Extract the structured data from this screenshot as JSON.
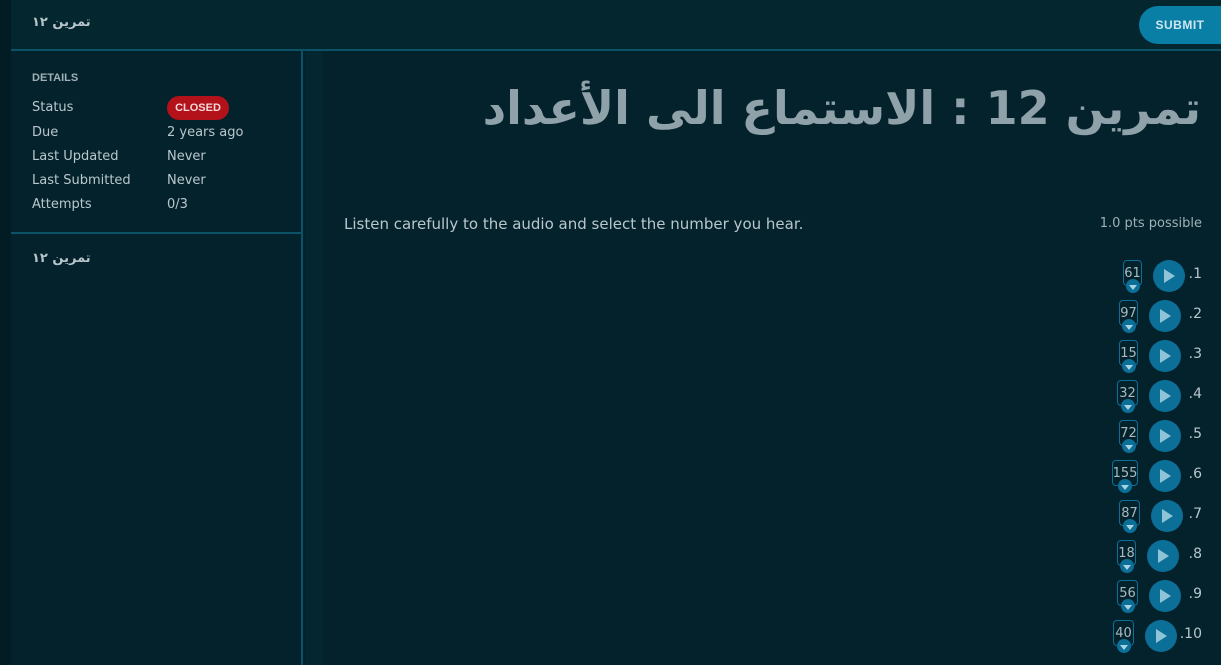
{
  "header": {
    "title": "تمرين ١٢",
    "submit_label": "SUBMIT"
  },
  "details": {
    "heading": "DETAILS",
    "rows": [
      {
        "label": "Status",
        "value": "CLOSED"
      },
      {
        "label": "Due",
        "value": "2 years ago"
      },
      {
        "label": "Last Updated",
        "value": "Never"
      },
      {
        "label": "Last Submitted",
        "value": "Never"
      },
      {
        "label": "Attempts",
        "value": "0/3"
      }
    ]
  },
  "sidebar": {
    "link_label": "تمرين ١٢"
  },
  "main": {
    "title": "تمرين 12 : الاستماع الى الأعداد",
    "instructions": "Listen carefully to the audio and select the number you hear.",
    "points": "1.0 pts possible",
    "questions": [
      {
        "num": ".1",
        "value": "61"
      },
      {
        "num": ".2",
        "value": "97"
      },
      {
        "num": ".3",
        "value": "15"
      },
      {
        "num": ".4",
        "value": "32"
      },
      {
        "num": ".5",
        "value": "72"
      },
      {
        "num": ".6",
        "value": "155"
      },
      {
        "num": ".7",
        "value": "87"
      },
      {
        "num": ".8",
        "value": "18"
      },
      {
        "num": ".9",
        "value": "56"
      },
      {
        "num": ".10",
        "value": "40"
      }
    ]
  },
  "colors": {
    "background": "#04222c",
    "accent": "#0a7fa6",
    "border": "#0b5266",
    "status_closed": "#b3121a"
  },
  "icons": {
    "play": "play-icon",
    "dropdown": "chevron-down-icon"
  }
}
